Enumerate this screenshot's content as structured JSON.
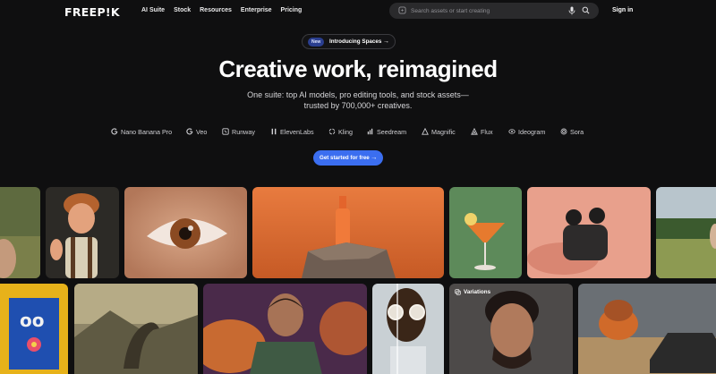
{
  "nav": {
    "logo": "FREEP!K",
    "menu": [
      "AI Suite",
      "Stock",
      "Resources",
      "Enterprise",
      "Pricing"
    ],
    "search_placeholder": "Search assets or start creating",
    "signin": "Sign in"
  },
  "hero": {
    "badge_new": "New",
    "badge_text": "Introducing Spaces",
    "headline": "Creative work, reimagined",
    "subtitle_line1": "One suite: top AI models, pro editing tools, and stock assets—",
    "subtitle_line2": "trusted by 700,000+ creatives.",
    "cta": "Get started for free"
  },
  "models": [
    {
      "label": "Nano Banana Pro",
      "icon": "google-g-icon"
    },
    {
      "label": "Veo",
      "icon": "google-g-icon"
    },
    {
      "label": "Runway",
      "icon": "runway-icon"
    },
    {
      "label": "ElevenLabs",
      "icon": "elevenlabs-icon"
    },
    {
      "label": "Kling",
      "icon": "kling-icon"
    },
    {
      "label": "Seedream",
      "icon": "seedream-icon"
    },
    {
      "label": "Magnific",
      "icon": "magnific-icon"
    },
    {
      "label": "Flux",
      "icon": "flux-icon"
    },
    {
      "label": "Ideogram",
      "icon": "ideogram-icon"
    },
    {
      "label": "Sora",
      "icon": "sora-icon"
    }
  ],
  "gallery": {
    "variations_label": "Variations",
    "tiles": [
      "portrait-field-image",
      "cartoon-character-image",
      "eye-closeup-image",
      "product-bottle-image",
      "cocktail-image",
      "earbuds-image",
      "running-field-image",
      "poster-flower-image",
      "dinosaur-landscape-image",
      "action-hero-image",
      "sunglasses-portrait-image",
      "man-portrait-image",
      "explosion-truck-image"
    ]
  },
  "colors": {
    "background": "#0f0f10",
    "accent": "#3b6ef0",
    "search_bg": "#2a2a2c"
  }
}
